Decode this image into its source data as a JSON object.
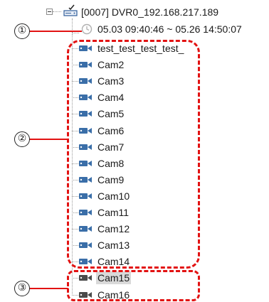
{
  "tree": {
    "dvr": {
      "label": "[0007] DVR0_192.168.217.189",
      "range": "05.03 09:40:46 ~ 05.26 14:50:07"
    },
    "cameras": [
      {
        "label": "test_test_test_test_",
        "icon": "camera-icon",
        "status": "active"
      },
      {
        "label": "Cam2",
        "icon": "camera-icon",
        "status": "active"
      },
      {
        "label": "Cam3",
        "icon": "camera-icon",
        "status": "active"
      },
      {
        "label": "Cam4",
        "icon": "camera-icon",
        "status": "active"
      },
      {
        "label": "Cam5",
        "icon": "camera-icon",
        "status": "active"
      },
      {
        "label": "Cam6",
        "icon": "camera-icon",
        "status": "active"
      },
      {
        "label": "Cam7",
        "icon": "camera-icon",
        "status": "active"
      },
      {
        "label": "Cam8",
        "icon": "camera-icon",
        "status": "active"
      },
      {
        "label": "Cam9",
        "icon": "camera-icon",
        "status": "active"
      },
      {
        "label": "Cam10",
        "icon": "camera-icon",
        "status": "active"
      },
      {
        "label": "Cam11",
        "icon": "camera-icon",
        "status": "active"
      },
      {
        "label": "Cam12",
        "icon": "camera-icon",
        "status": "active"
      },
      {
        "label": "Cam13",
        "icon": "camera-icon",
        "status": "active"
      },
      {
        "label": "Cam14",
        "icon": "camera-icon",
        "status": "active"
      },
      {
        "label": "Cam15",
        "icon": "camera-icon",
        "status": "inactive",
        "selected": true
      },
      {
        "label": "Cam16",
        "icon": "camera-icon",
        "status": "inactive"
      }
    ]
  },
  "annotations": {
    "callout_1": "①",
    "callout_2": "②",
    "callout_3": "③"
  },
  "colors": {
    "active_camera": "#3a6ea8",
    "inactive_camera": "#4a4a4a",
    "annotation": "#e21212",
    "clock": "#b0b0b0"
  }
}
